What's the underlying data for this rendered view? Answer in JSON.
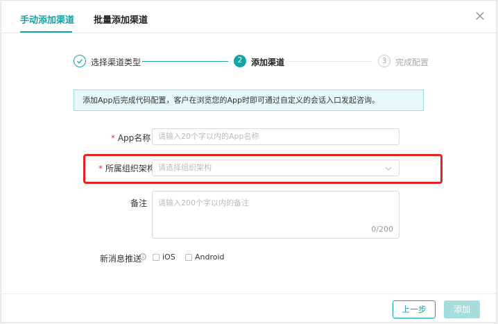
{
  "tabs": [
    {
      "label": "手动添加渠道",
      "active": true
    },
    {
      "label": "批量添加渠道",
      "active": false
    }
  ],
  "steps": [
    {
      "label": "选择渠道类型",
      "number": "",
      "state": "done"
    },
    {
      "label": "添加渠道",
      "number": "2",
      "state": "active"
    },
    {
      "label": "完成配置",
      "number": "3",
      "state": "pending"
    }
  ],
  "info_banner": "添加App后完成代码配置，客户在浏览您的App时即可通过自定义的会话入口发起咨询。",
  "form": {
    "app_name": {
      "required_mark": "*",
      "label": "App名称",
      "placeholder": "请输入20个字以内的App名称"
    },
    "org": {
      "required_mark": "*",
      "label": "所属组织架构",
      "placeholder": "请选择组织架构"
    },
    "remark": {
      "label": "备注",
      "placeholder": "请输入200个字以内的备注",
      "counter": "0/200"
    },
    "push": {
      "label": "新消息推送",
      "options": [
        "iOS",
        "Android"
      ]
    }
  },
  "buttons": {
    "prev": "上一步",
    "add": "添加"
  },
  "colors": {
    "accent": "#13a3a5",
    "highlight": "#e8231f"
  },
  "icons": [
    "close-icon",
    "check-icon",
    "chevron-down-icon",
    "info-icon"
  ]
}
